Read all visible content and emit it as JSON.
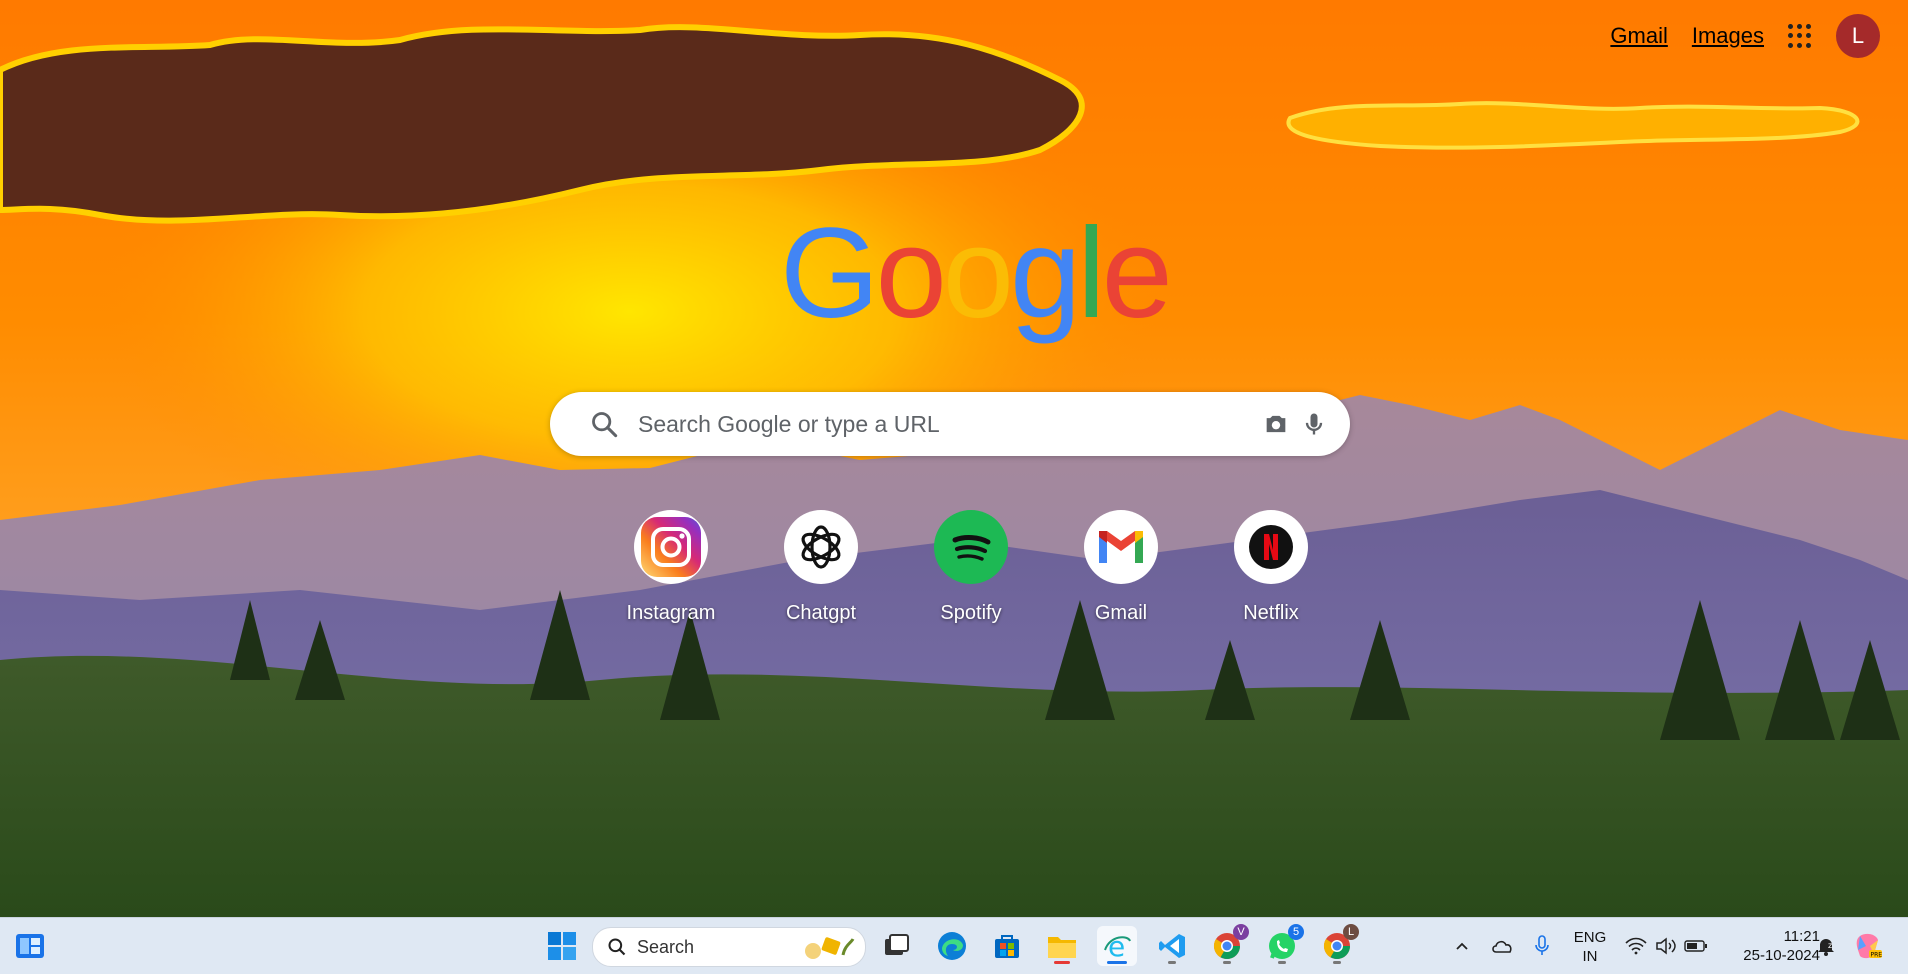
{
  "header": {
    "gmail_link": "Gmail",
    "images_link": "Images",
    "avatar_initial": "L"
  },
  "logo": {
    "letters": [
      "G",
      "o",
      "o",
      "g",
      "l",
      "e"
    ],
    "colors": [
      "#4285F4",
      "#EA4335",
      "#FBBC05",
      "#4285F4",
      "#34A853",
      "#EA4335"
    ]
  },
  "search": {
    "placeholder": "Search Google or type a URL"
  },
  "shortcuts": [
    {
      "label": "Instagram"
    },
    {
      "label": "Chatgpt"
    },
    {
      "label": "Spotify"
    },
    {
      "label": "Gmail"
    },
    {
      "label": "Netflix"
    }
  ],
  "taskbar": {
    "search_label": "Search",
    "chrome_v_badge": "V",
    "whatsapp_badge": "5",
    "chrome_l_badge": "L",
    "language_line1": "ENG",
    "language_line2": "IN",
    "time": "11:21",
    "date": "25-10-2024"
  },
  "colors": {
    "avatar": "#a52a2a",
    "taskbar_bg": "#dfe8f3",
    "brand_blue": "#4285F4"
  }
}
